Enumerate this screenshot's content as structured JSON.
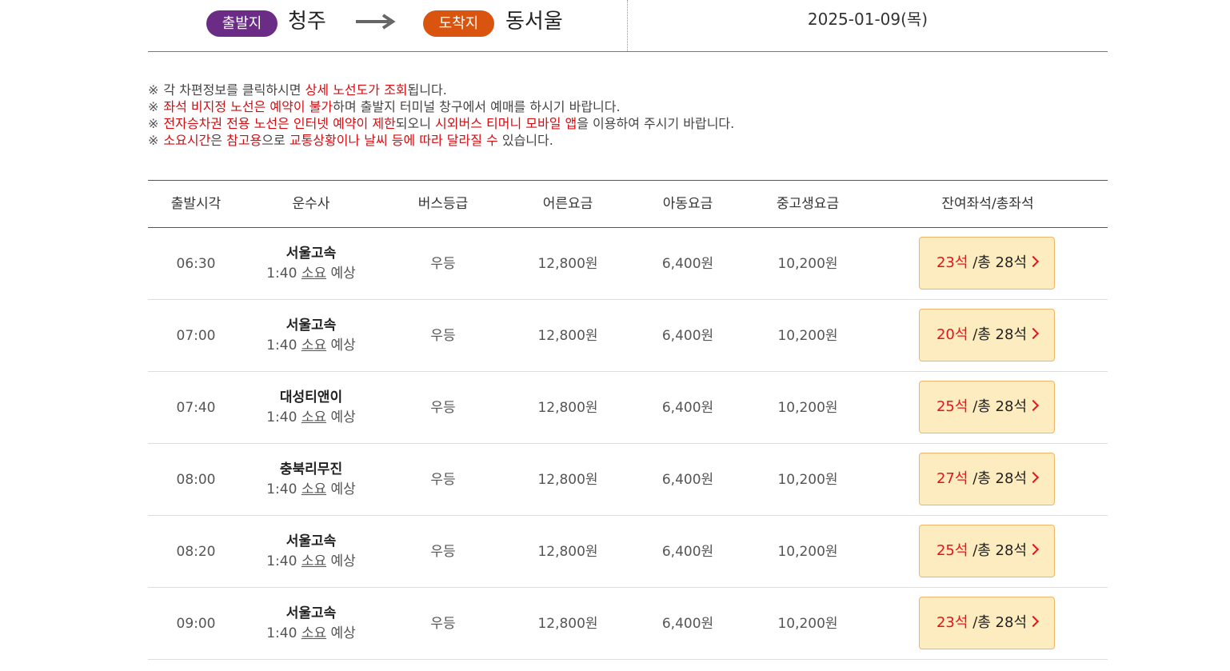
{
  "route": {
    "departure_label": "출발지",
    "departure_city": "청주",
    "arrival_label": "도착지",
    "arrival_city": "동서울",
    "date": "2025-01-09(목)"
  },
  "notices": [
    {
      "mark": "※",
      "parts": [
        {
          "text": "각 차편정보를 클릭하시면 ",
          "red": false
        },
        {
          "text": "상세 노선도가 조회",
          "red": true
        },
        {
          "text": "됩니다.",
          "red": false
        }
      ]
    },
    {
      "mark": "※",
      "parts": [
        {
          "text": "좌석 비지정 노선은 예약이 불가",
          "red": true
        },
        {
          "text": "하며 출발지 터미널 창구에서 예매를 하시기 바랍니다.",
          "red": false
        }
      ]
    },
    {
      "mark": "※",
      "parts": [
        {
          "text": "전자승차권 전용 노선은 인터넷 예약이 제한",
          "red": true
        },
        {
          "text": "되오니 ",
          "red": false
        },
        {
          "text": "시외버스 티머니 모바일 앱",
          "red": true
        },
        {
          "text": "을 이용하여 주시기 바랍니다.",
          "red": false
        }
      ]
    },
    {
      "mark": "※",
      "parts": [
        {
          "text": "소요시간",
          "red": true
        },
        {
          "text": "은 ",
          "red": false
        },
        {
          "text": "참고용",
          "red": true
        },
        {
          "text": "으로 ",
          "red": false
        },
        {
          "text": "교통상황이나 날씨 등에 따라 달라질 수",
          "red": true
        },
        {
          "text": " 있습니다.",
          "red": false
        }
      ]
    }
  ],
  "table": {
    "headers": {
      "time": "출발시각",
      "company": "운수사",
      "grade": "버스등급",
      "adult": "어른요금",
      "child": "아동요금",
      "student": "중고생요금",
      "seats": "잔여좌석/총좌석"
    },
    "rows": [
      {
        "time": "06:30",
        "company": "서울고속",
        "duration": "1:40",
        "duration_u": "소요",
        "duration_suffix": "예상",
        "grade": "우등",
        "adult": "12,800원",
        "child": "6,400원",
        "student": "10,200원",
        "remain": "23석",
        "total": "/총 28석"
      },
      {
        "time": "07:00",
        "company": "서울고속",
        "duration": "1:40",
        "duration_u": "소요",
        "duration_suffix": "예상",
        "grade": "우등",
        "adult": "12,800원",
        "child": "6,400원",
        "student": "10,200원",
        "remain": "20석",
        "total": "/총 28석"
      },
      {
        "time": "07:40",
        "company": "대성티앤이",
        "duration": "1:40",
        "duration_u": "소요",
        "duration_suffix": "예상",
        "grade": "우등",
        "adult": "12,800원",
        "child": "6,400원",
        "student": "10,200원",
        "remain": "25석",
        "total": "/총 28석"
      },
      {
        "time": "08:00",
        "company": "충북리무진",
        "duration": "1:40",
        "duration_u": "소요",
        "duration_suffix": "예상",
        "grade": "우등",
        "adult": "12,800원",
        "child": "6,400원",
        "student": "10,200원",
        "remain": "27석",
        "total": "/총 28석"
      },
      {
        "time": "08:20",
        "company": "서울고속",
        "duration": "1:40",
        "duration_u": "소요",
        "duration_suffix": "예상",
        "grade": "우등",
        "adult": "12,800원",
        "child": "6,400원",
        "student": "10,200원",
        "remain": "25석",
        "total": "/총 28석"
      },
      {
        "time": "09:00",
        "company": "서울고속",
        "duration": "1:40",
        "duration_u": "소요",
        "duration_suffix": "예상",
        "grade": "우등",
        "adult": "12,800원",
        "child": "6,400원",
        "student": "10,200원",
        "remain": "23석",
        "total": "/총 28석"
      }
    ]
  },
  "colors": {
    "departure_pill": "#6b2c85",
    "arrival_pill": "#d9540f",
    "highlight_red": "#d40d12",
    "seat_button_bg": "#fdecbf"
  }
}
